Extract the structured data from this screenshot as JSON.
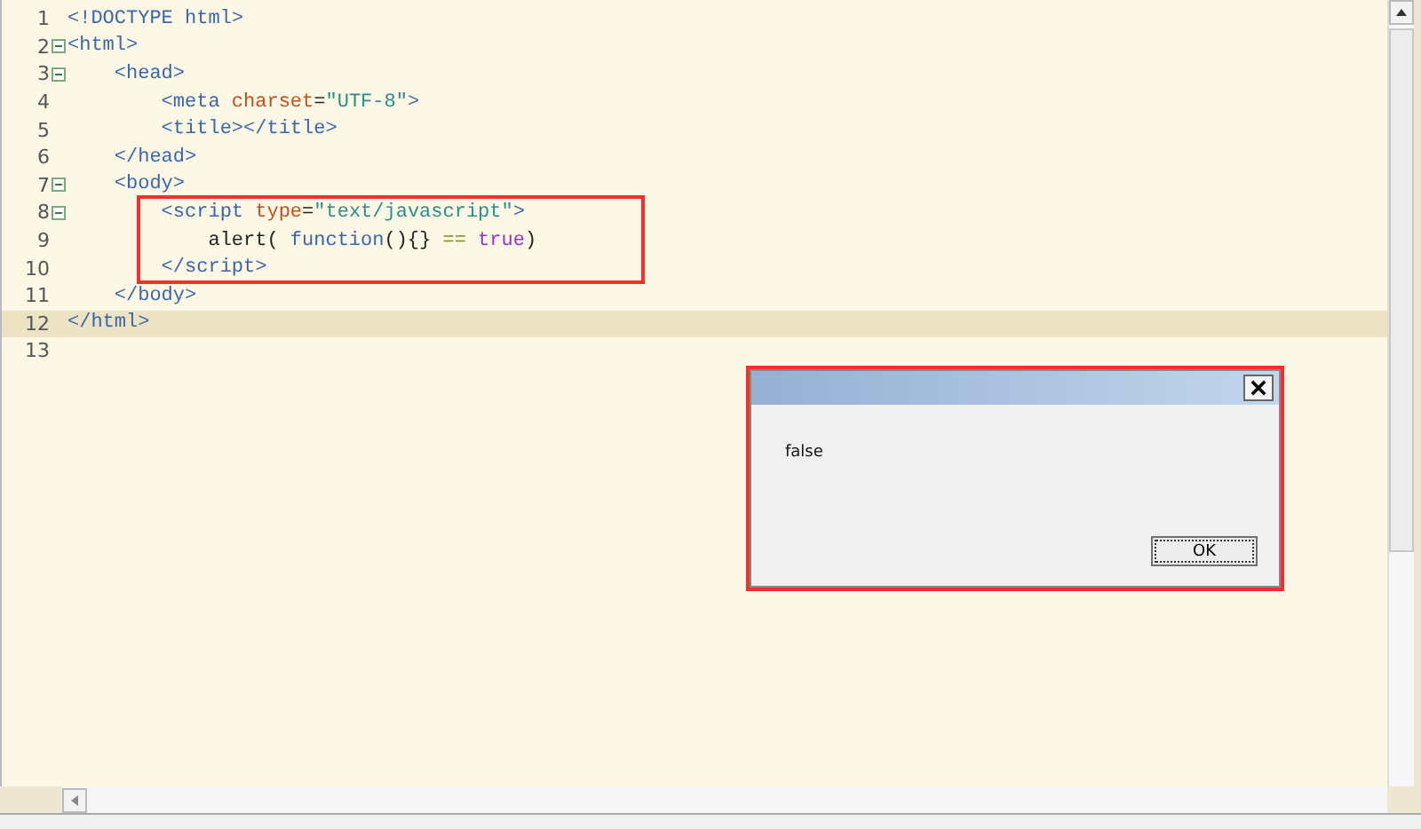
{
  "editor": {
    "lines": [
      {
        "number": "1",
        "fold": false,
        "current": false,
        "boxed": false,
        "tokens": [
          {
            "text": "<!DOCTYPE html>",
            "kind": "tag"
          }
        ]
      },
      {
        "number": "2",
        "fold": true,
        "current": false,
        "boxed": false,
        "tokens": [
          {
            "text": "<html>",
            "kind": "tag"
          }
        ]
      },
      {
        "number": "3",
        "fold": true,
        "current": false,
        "boxed": false,
        "tokens": [
          {
            "text": "    <head>",
            "kind": "tag"
          }
        ]
      },
      {
        "number": "4",
        "fold": false,
        "current": false,
        "boxed": false,
        "tokens": [
          {
            "text": "        <meta ",
            "kind": "tag"
          },
          {
            "text": "charset",
            "kind": "attr"
          },
          {
            "text": "=",
            "kind": "plain"
          },
          {
            "text": "\"UTF-8\"",
            "kind": "string"
          },
          {
            "text": ">",
            "kind": "tag"
          }
        ]
      },
      {
        "number": "5",
        "fold": false,
        "current": false,
        "boxed": false,
        "tokens": [
          {
            "text": "        <title></title>",
            "kind": "tag"
          }
        ]
      },
      {
        "number": "6",
        "fold": false,
        "current": false,
        "boxed": false,
        "tokens": [
          {
            "text": "    </head>",
            "kind": "tag"
          }
        ]
      },
      {
        "number": "7",
        "fold": true,
        "current": false,
        "boxed": false,
        "tokens": [
          {
            "text": "    <body>",
            "kind": "tag"
          }
        ]
      },
      {
        "number": "8",
        "fold": true,
        "current": false,
        "boxed": true,
        "tokens": [
          {
            "text": "        <script ",
            "kind": "tag"
          },
          {
            "text": "type",
            "kind": "attr"
          },
          {
            "text": "=",
            "kind": "plain"
          },
          {
            "text": "\"text/javascript\"",
            "kind": "string"
          },
          {
            "text": ">",
            "kind": "tag"
          }
        ]
      },
      {
        "number": "9",
        "fold": false,
        "current": false,
        "boxed": true,
        "tokens": [
          {
            "text": "            alert( ",
            "kind": "plain"
          },
          {
            "text": "function",
            "kind": "keyword"
          },
          {
            "text": "(){} ",
            "kind": "plain"
          },
          {
            "text": "==",
            "kind": "operator"
          },
          {
            "text": " true",
            "kind": "value"
          },
          {
            "text": ")",
            "kind": "plain"
          }
        ]
      },
      {
        "number": "10",
        "fold": false,
        "current": false,
        "boxed": true,
        "tokens": [
          {
            "text": "        </script>",
            "kind": "tag"
          }
        ]
      },
      {
        "number": "11",
        "fold": false,
        "current": false,
        "boxed": false,
        "tokens": [
          {
            "text": "    </body>",
            "kind": "tag"
          }
        ]
      },
      {
        "number": "12",
        "fold": false,
        "current": true,
        "boxed": false,
        "tokens": [
          {
            "text": "</html>",
            "kind": "tag"
          }
        ]
      },
      {
        "number": "13",
        "fold": false,
        "current": false,
        "boxed": false
      }
    ]
  },
  "dialog": {
    "message": "false",
    "button": "OK",
    "annotated": true
  }
}
